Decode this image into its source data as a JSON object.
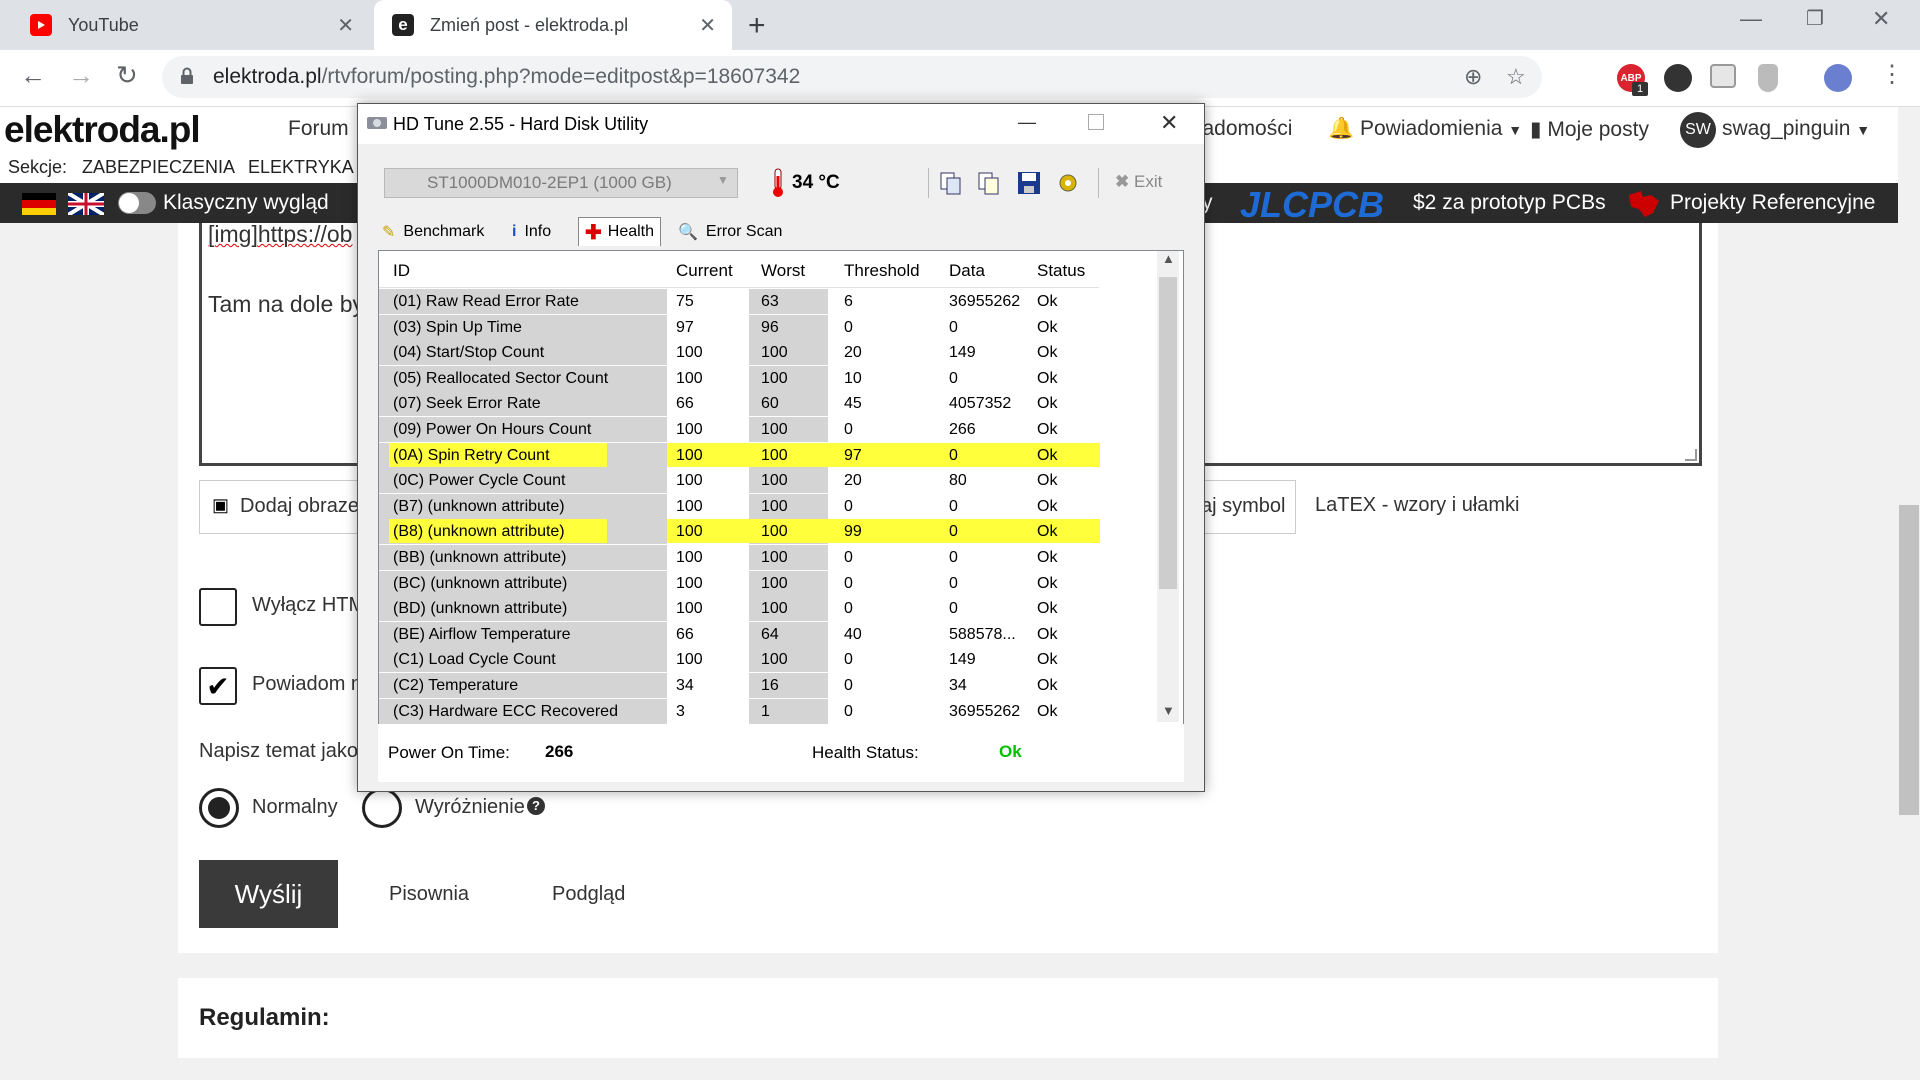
{
  "browser": {
    "tabs": [
      {
        "title": "YouTube",
        "favicon": "youtube-icon",
        "active": false
      },
      {
        "title": "Zmień post - elektroda.pl",
        "favicon": "elektroda-icon",
        "active": true
      }
    ],
    "url_host": "elektroda.pl",
    "url_path": "/rtvforum/posting.php?mode=editpost&p=18607342",
    "extensions": [
      "abp-icon",
      "vpn-icon",
      "cast-icon",
      "shield-icon",
      "profile-avatar"
    ],
    "abp_badge": "1"
  },
  "site": {
    "logo": "elektroda.pl",
    "nav": {
      "forum": "Forum",
      "messages": "Wiadomości",
      "notifications": "Powiadomienia",
      "my_posts": "Moje posty",
      "user_initials": "SW",
      "username": "swag_pinguin"
    },
    "sections_label": "Sekcje:",
    "sections": [
      "ZABEZPIECZENIA",
      "ELEKTRYKA"
    ],
    "classic_view": "Klasyczny wygląd",
    "ad_brand": "JLCPCB",
    "ad_text": "$2 za prototyp PCBs",
    "ad_trailing": "y",
    "ref_projects": "Projekty Referencyjne"
  },
  "editor": {
    "line1": "[img]https://ob",
    "line2": "Tam na dole by",
    "add_image": "Dodaj obraze",
    "symbol": "aj symbol",
    "latex": "LaTEX - wzory i ułamki",
    "disable_html": "Wyłącz HTM",
    "notify": "Powiadom m",
    "topic_label": "Napisz temat jako",
    "radio_normal": "Normalny",
    "radio_highlight": "Wyróżnienie",
    "help_glyph": "?",
    "send": "Wyślij",
    "spelling": "Pisownia",
    "preview": "Podgląd",
    "rules": "Regulamin:"
  },
  "hdtune": {
    "title": "HD Tune 2.55 - Hard Disk Utility",
    "drive": "ST1000DM010-2EP1 (1000 GB)",
    "temperature": "34 °C",
    "exit": "Exit",
    "tabs": [
      "Benchmark",
      "Info",
      "Health",
      "Error Scan"
    ],
    "active_tab": "Health",
    "columns": [
      "ID",
      "Current",
      "Worst",
      "Threshold",
      "Data",
      "Status"
    ],
    "rows": [
      {
        "id": "(01) Raw Read Error Rate",
        "current": "75",
        "worst": "63",
        "threshold": "6",
        "data": "36955262",
        "status": "Ok",
        "highlight": false
      },
      {
        "id": "(03) Spin Up Time",
        "current": "97",
        "worst": "96",
        "threshold": "0",
        "data": "0",
        "status": "Ok",
        "highlight": false
      },
      {
        "id": "(04) Start/Stop Count",
        "current": "100",
        "worst": "100",
        "threshold": "20",
        "data": "149",
        "status": "Ok",
        "highlight": false
      },
      {
        "id": "(05) Reallocated Sector Count",
        "current": "100",
        "worst": "100",
        "threshold": "10",
        "data": "0",
        "status": "Ok",
        "highlight": false
      },
      {
        "id": "(07) Seek Error Rate",
        "current": "66",
        "worst": "60",
        "threshold": "45",
        "data": "4057352",
        "status": "Ok",
        "highlight": false
      },
      {
        "id": "(09) Power On Hours Count",
        "current": "100",
        "worst": "100",
        "threshold": "0",
        "data": "266",
        "status": "Ok",
        "highlight": false
      },
      {
        "id": "(0A) Spin Retry Count",
        "current": "100",
        "worst": "100",
        "threshold": "97",
        "data": "0",
        "status": "Ok",
        "highlight": true
      },
      {
        "id": "(0C) Power Cycle Count",
        "current": "100",
        "worst": "100",
        "threshold": "20",
        "data": "80",
        "status": "Ok",
        "highlight": false
      },
      {
        "id": "(B7) (unknown attribute)",
        "current": "100",
        "worst": "100",
        "threshold": "0",
        "data": "0",
        "status": "Ok",
        "highlight": false
      },
      {
        "id": "(B8) (unknown attribute)",
        "current": "100",
        "worst": "100",
        "threshold": "99",
        "data": "0",
        "status": "Ok",
        "highlight": true
      },
      {
        "id": "(BB) (unknown attribute)",
        "current": "100",
        "worst": "100",
        "threshold": "0",
        "data": "0",
        "status": "Ok",
        "highlight": false
      },
      {
        "id": "(BC) (unknown attribute)",
        "current": "100",
        "worst": "100",
        "threshold": "0",
        "data": "0",
        "status": "Ok",
        "highlight": false
      },
      {
        "id": "(BD) (unknown attribute)",
        "current": "100",
        "worst": "100",
        "threshold": "0",
        "data": "0",
        "status": "Ok",
        "highlight": false
      },
      {
        "id": "(BE) Airflow Temperature",
        "current": "66",
        "worst": "64",
        "threshold": "40",
        "data": "588578...",
        "status": "Ok",
        "highlight": false
      },
      {
        "id": "(C1) Load Cycle Count",
        "current": "100",
        "worst": "100",
        "threshold": "0",
        "data": "149",
        "status": "Ok",
        "highlight": false
      },
      {
        "id": "(C2) Temperature",
        "current": "34",
        "worst": "16",
        "threshold": "0",
        "data": "34",
        "status": "Ok",
        "highlight": false
      },
      {
        "id": "(C3) Hardware ECC Recovered",
        "current": "3",
        "worst": "1",
        "threshold": "0",
        "data": "36955262",
        "status": "Ok",
        "highlight": false
      }
    ],
    "power_on_label": "Power On Time:",
    "power_on_value": "266",
    "health_label": "Health Status:",
    "health_value": "Ok",
    "colors": {
      "highlight": "#ffff3c",
      "ok_green": "#00c000",
      "selected_col": "#d4d4d4"
    }
  }
}
